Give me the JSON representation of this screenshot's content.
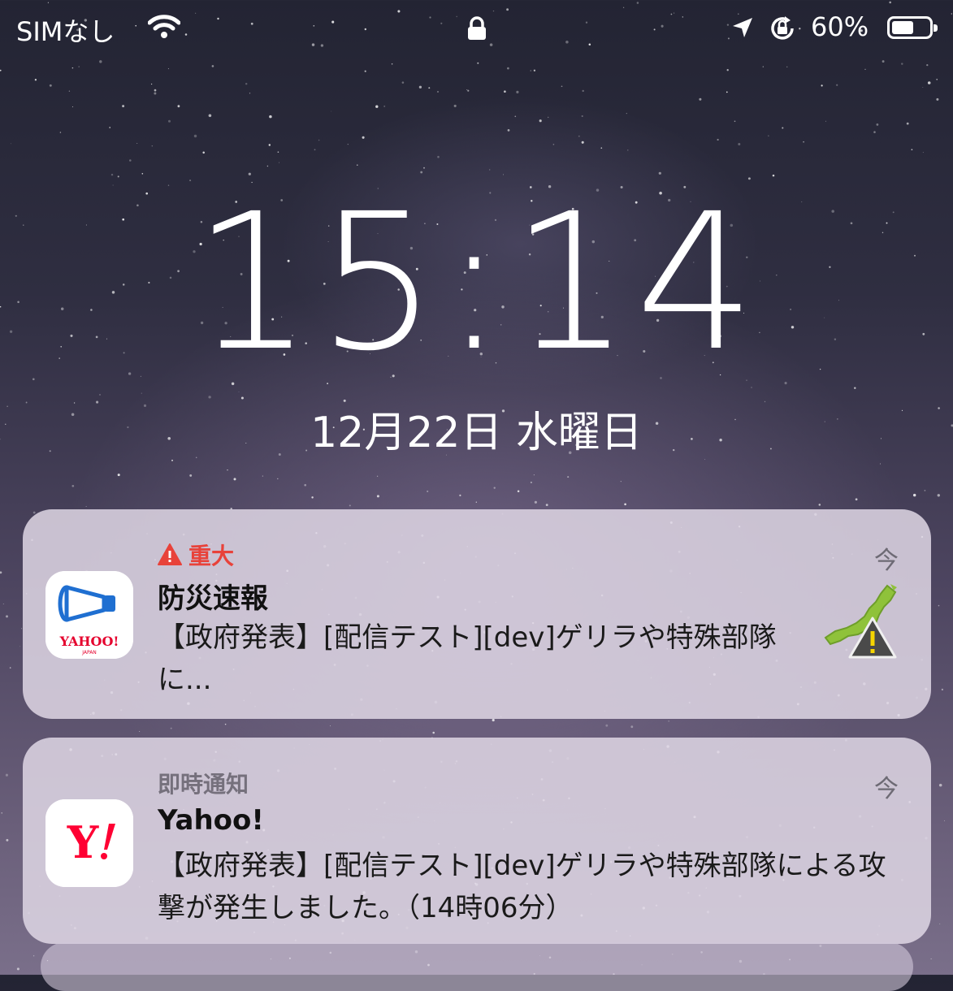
{
  "status_bar": {
    "carrier": "SIMなし",
    "battery_percent": "60%",
    "battery_level": 0.6
  },
  "lock_screen": {
    "time": "15:14",
    "date": "12月22日 水曜日"
  },
  "notifications": [
    {
      "category": "重大",
      "category_color": "#e8423a",
      "title": "防災速報",
      "body": "【政府発表】[配信テスト][dev]ゲリラや特殊部隊に...",
      "time": "今",
      "app_icon": "yahoo-bousai-megaphone-icon",
      "thumbnail": "japan-map-warning-icon"
    },
    {
      "category": "即時通知",
      "title": "Yahoo!",
      "body": "【政府発表】[配信テスト][dev]ゲリラや特殊部隊による攻撃が発生しました。（14時06分）",
      "time": "今",
      "app_icon": "yahoo-japan-logo-icon",
      "brand_color": "#ff0033"
    }
  ]
}
